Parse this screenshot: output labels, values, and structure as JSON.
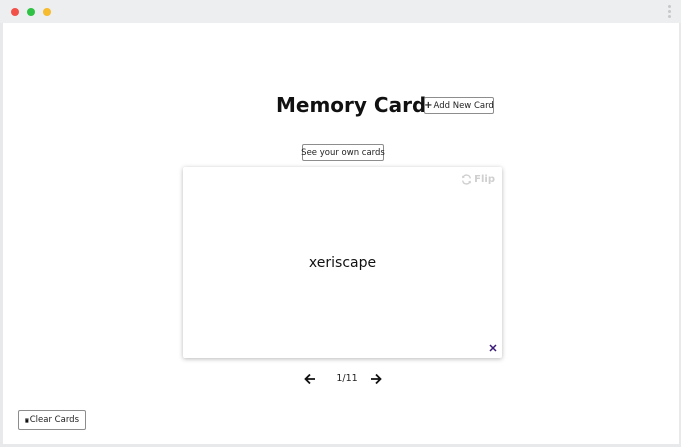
{
  "app": {
    "title": "Memory Cards",
    "add_button_label": "Add New Card",
    "see_own_button_label": "See your own cards",
    "clear_button_label": "Clear Cards"
  },
  "card": {
    "flip_label": "Flip",
    "word": "xeriscape"
  },
  "navigation": {
    "counter": "1/11"
  },
  "icons": {
    "add": "plus-icon",
    "flip": "sync-icon",
    "delete": "close-icon",
    "prev": "arrow-left-icon",
    "next": "arrow-right-icon",
    "clear": "trash-icon"
  },
  "colors": {
    "delete_icon": "#3a1b7a",
    "flip_text": "#cfcfcf"
  }
}
